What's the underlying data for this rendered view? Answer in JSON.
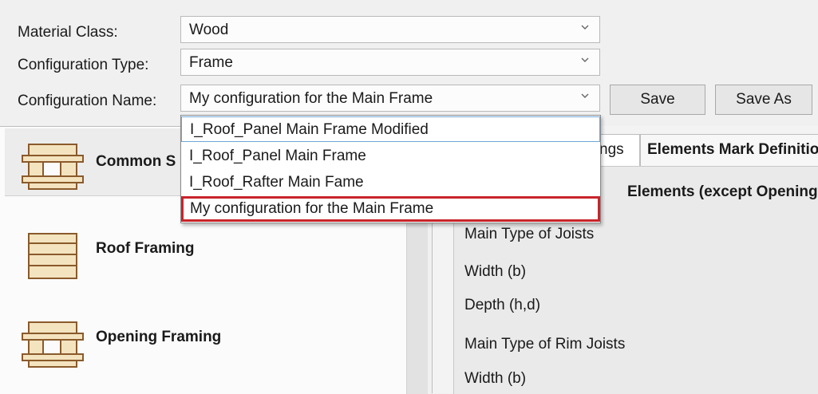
{
  "form": {
    "material_class": {
      "label": "Material Class:",
      "value": "Wood"
    },
    "configuration_type": {
      "label": "Configuration Type:",
      "value": "Frame"
    },
    "configuration_name": {
      "label": "Configuration Name:",
      "value": "My configuration for the Main Frame"
    }
  },
  "buttons": {
    "save": "Save",
    "save_as": "Save As"
  },
  "dropdown": {
    "options": [
      "I_Roof_Panel Main Frame Modified",
      "I_Roof_Panel Main Frame",
      "I_Roof_Rafter Main Fame",
      "My configuration for the Main Frame"
    ],
    "highlight_color": "#c9242b"
  },
  "left_list": {
    "items": [
      "Common S",
      "Roof Framing",
      "Opening Framing"
    ]
  },
  "tabs": [
    "ngs",
    "Elements Mark Definitio"
  ],
  "content": {
    "group_heading": "Elements (except Openings)",
    "rows": [
      "Main Type of Joists",
      "Width (b)",
      "Depth (h,d)",
      "Main Type of Rim Joists",
      "Width (b)"
    ]
  },
  "icons": [
    "chevron-down-icon",
    "frame-panel-icon",
    "roof-frame-icon",
    "opening-frame-icon"
  ]
}
